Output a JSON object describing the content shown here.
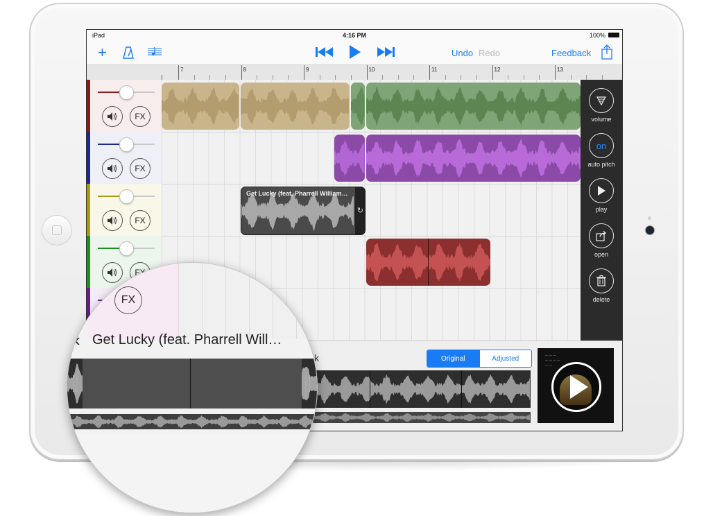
{
  "status": {
    "device": "iPad",
    "time": "4:16 PM",
    "battery": "100%"
  },
  "toolbar": {
    "add_icon": "plus-icon",
    "metronome_icon": "metronome-icon",
    "score_icon": "score-icon",
    "undo": "Undo",
    "redo": "Redo",
    "feedback": "Feedback",
    "share_icon": "share-icon"
  },
  "ruler": {
    "labels": [
      "7",
      "8",
      "9",
      "10",
      "11",
      "12",
      "13"
    ]
  },
  "tracks": [
    {
      "color": "#8b1a1a",
      "bg": "#f7eded",
      "volume": 0.5,
      "fx": "FX"
    },
    {
      "color": "#1d2a8c",
      "bg": "#eeeff7",
      "volume": 0.5,
      "fx": "FX"
    },
    {
      "color": "#a89a16",
      "bg": "#f8f7e8",
      "volume": 0.5,
      "fx": "FX"
    },
    {
      "color": "#1f8f1f",
      "bg": "#ecf6ec",
      "volume": 0.5,
      "fx": "FX"
    },
    {
      "color": "#6a1b8c",
      "bg": "#f4ecf7",
      "volume": 0.5,
      "fx": "FX"
    }
  ],
  "clips": {
    "selected_title": "Get Lucky (feat. Pharrell William…"
  },
  "right_panel": [
    {
      "icon": "volume-icon",
      "label": "volume"
    },
    {
      "icon": "on-toggle",
      "symbol": "on",
      "label": "auto pitch"
    },
    {
      "icon": "play-icon",
      "label": "play"
    },
    {
      "icon": "open-icon",
      "label": "open"
    },
    {
      "icon": "trash-icon",
      "label": "delete"
    }
  ],
  "bottom": {
    "title_tail": "k",
    "segment": {
      "original": "Original",
      "adjusted": "Adjusted",
      "selected": "Original"
    }
  },
  "loupe": {
    "title": "Get Lucky (feat. Pharrell Will…",
    "fx": "FX"
  }
}
